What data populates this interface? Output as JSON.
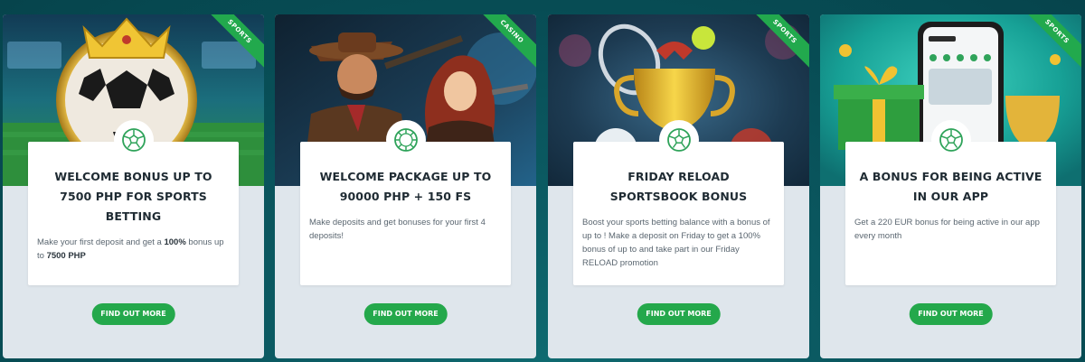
{
  "cards": [
    {
      "ribbon": "SPORTS",
      "title": "WELCOME BONUS UP TO 7500 PHP FOR SPORTS BETTING",
      "desc_pre": "Make your first deposit and get a ",
      "desc_bold1": "100%",
      "desc_mid": " bonus up to ",
      "desc_bold2": "7500 PHP",
      "cta": "FIND OUT MORE",
      "icon": "soccer-ball-icon"
    },
    {
      "ribbon": "CASINO",
      "title": "WELCOME PACKAGE UP TO 90000 PHP + 150 FS",
      "desc": "Make deposits and get bonuses for your first 4 deposits!",
      "cta": "FIND OUT MORE",
      "icon": "casino-chip-icon"
    },
    {
      "ribbon": "SPORTS",
      "title": "FRIDAY RELOAD SPORTSBOOK BONUS",
      "desc": "Boost your sports betting balance with a bonus of up to ! Make a deposit on Friday to get a 100% bonus of up to and take part in our Friday RELOAD promotion",
      "cta": "FIND OUT MORE",
      "icon": "soccer-ball-icon"
    },
    {
      "ribbon": "SPORTS",
      "title": "A BONUS FOR BEING ACTIVE IN OUR APP",
      "desc": "Get a 220 EUR bonus for being active in our app every month",
      "cta": "FIND OUT MORE",
      "icon": "soccer-ball-icon"
    }
  ],
  "colors": {
    "accent": "#24a84b",
    "icon": "#2fa35a",
    "panel": "#ffffff",
    "card": "#dfe6ec",
    "background": "#074c54"
  }
}
